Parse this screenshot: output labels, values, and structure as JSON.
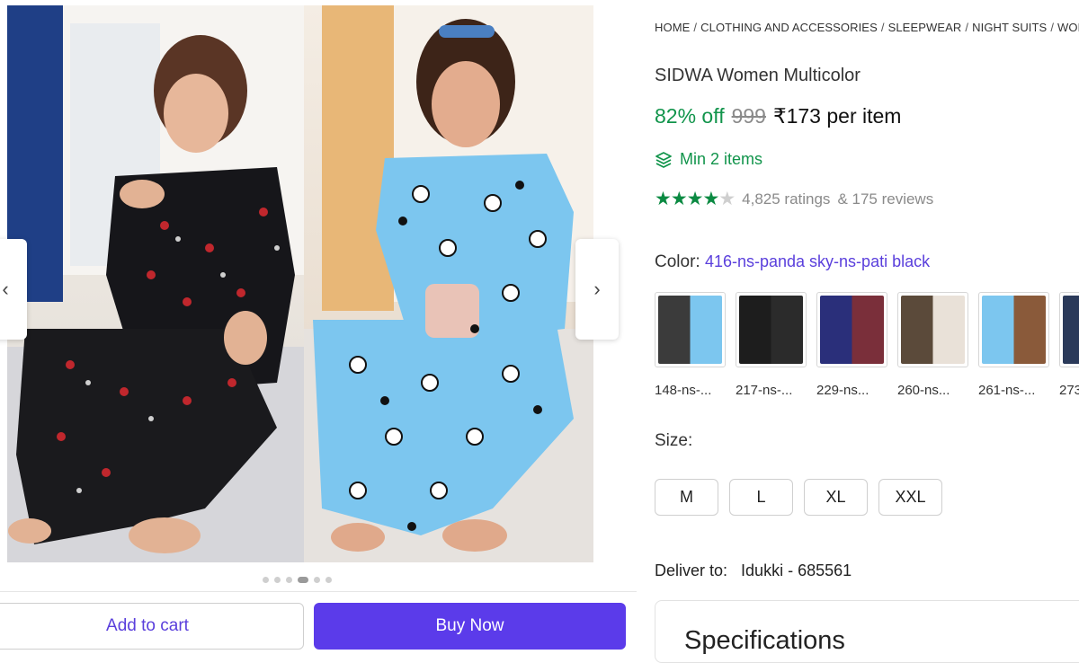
{
  "gallery": {
    "prev_icon": "chevron-left-icon",
    "next_icon": "chevron-right-icon",
    "dots_count": 6,
    "active_dot": 3,
    "colors": {
      "left_outfit": "#16161a",
      "right_outfit": "#7cc6ef",
      "curtain": "#1f3f86"
    }
  },
  "actions": {
    "add_to_cart": "Add to cart",
    "buy_now": "Buy Now"
  },
  "product": {
    "breadcrumb": [
      "HOME",
      "CLOTHING AND ACCESSORIES",
      "SLEEPWEAR",
      "NIGHT SUITS",
      "WOME"
    ],
    "title": "SIDWA Women Multicolor",
    "discount": "82% off",
    "mrp": "999",
    "price": "₹173 per item",
    "min_icon": "layers-icon",
    "min_text": "Min 2 items",
    "rating": 4,
    "rating_max": 5,
    "ratings_text": "4,825 ratings",
    "reviews_text": "& 175 reviews",
    "color_label": "Color:",
    "color_value": "416-ns-panda sky-ns-pati black",
    "swatches": [
      {
        "label": "148-ns-...",
        "a": "#3b3b3b",
        "b": "#7cc6ef"
      },
      {
        "label": "217-ns-...",
        "a": "#1d1d1d",
        "b": "#2b2b2b"
      },
      {
        "label": "229-ns...",
        "a": "#2a2f7a",
        "b": "#7a2f3a"
      },
      {
        "label": "260-ns...",
        "a": "#5b4a3a",
        "b": "#e9e1d8"
      },
      {
        "label": "261-ns-...",
        "a": "#7cc6ef",
        "b": "#8a5a3a"
      },
      {
        "label": "273",
        "a": "#2b3a5a",
        "b": "#dcdcdc"
      }
    ],
    "size_label": "Size:",
    "sizes": [
      "M",
      "L",
      "XL",
      "XXL"
    ],
    "deliver_label": "Deliver to:",
    "deliver_location": "Idukki - 685561",
    "specifications_title": "Specifications"
  },
  "colors": {
    "accent": "#5b3bea",
    "discount_green": "#11944b",
    "link_purple": "#5a3fdc"
  }
}
